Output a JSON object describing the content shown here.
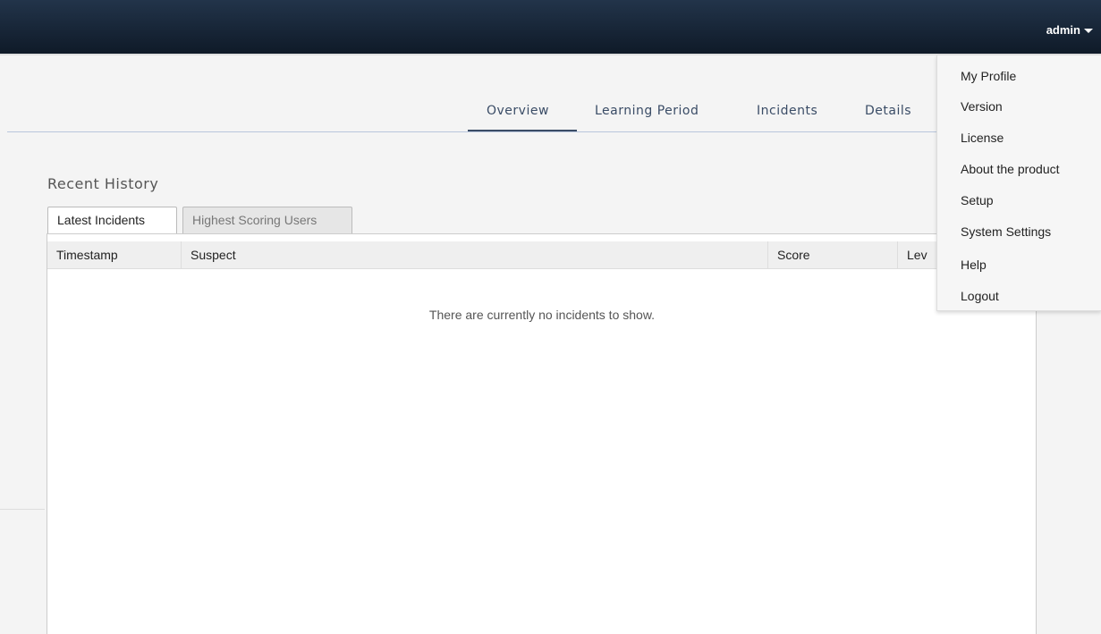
{
  "header": {
    "user_label": "admin"
  },
  "nav": {
    "tabs": [
      {
        "label": "Overview",
        "active": true
      },
      {
        "label": "Learning Period",
        "active": false
      },
      {
        "label": "Incidents",
        "active": false
      },
      {
        "label": "Details",
        "active": false
      }
    ]
  },
  "main": {
    "section_title": "Recent History",
    "tabs": [
      {
        "label": "Latest Incidents",
        "active": true
      },
      {
        "label": "Highest Scoring Users",
        "active": false
      }
    ],
    "table": {
      "columns": [
        "Timestamp",
        "Suspect",
        "Score",
        "Lev"
      ],
      "empty_message": "There are currently no incidents to show."
    }
  },
  "user_dropdown": {
    "items": [
      "My Profile",
      "Version",
      "License",
      "About the product",
      "Setup",
      "System Settings",
      "Help",
      "Logout"
    ]
  },
  "colors": {
    "topbar": "#1a2a3d",
    "nav_text": "#3a4c66"
  }
}
